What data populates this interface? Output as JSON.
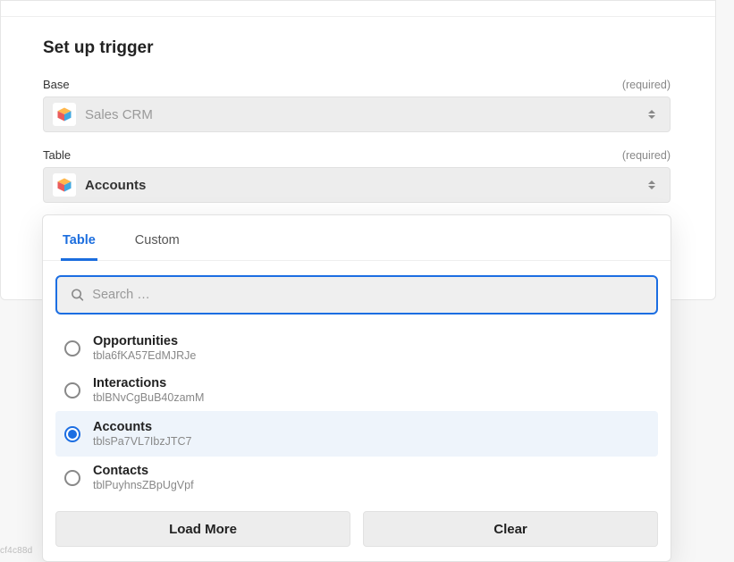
{
  "page": {
    "title": "Set up trigger"
  },
  "fields": {
    "base": {
      "label": "Base",
      "required_text": "(required)",
      "value": "Sales CRM"
    },
    "table": {
      "label": "Table",
      "required_text": "(required)",
      "value": "Accounts"
    }
  },
  "dropdown": {
    "tabs": {
      "table": "Table",
      "custom": "Custom",
      "active": "table"
    },
    "search_placeholder": "Search …",
    "options": [
      {
        "label": "Opportunities",
        "id": "tbla6fKA57EdMJRJe",
        "selected": false
      },
      {
        "label": "Interactions",
        "id": "tblBNvCgBuB40zamM",
        "selected": false
      },
      {
        "label": "Accounts",
        "id": "tblsPa7VL7IbzJTC7",
        "selected": true
      },
      {
        "label": "Contacts",
        "id": "tblPuyhnsZBpUgVpf",
        "selected": false
      }
    ],
    "buttons": {
      "load_more": "Load More",
      "clear": "Clear"
    }
  },
  "footer": {
    "build_hash": "cf4c88d"
  }
}
